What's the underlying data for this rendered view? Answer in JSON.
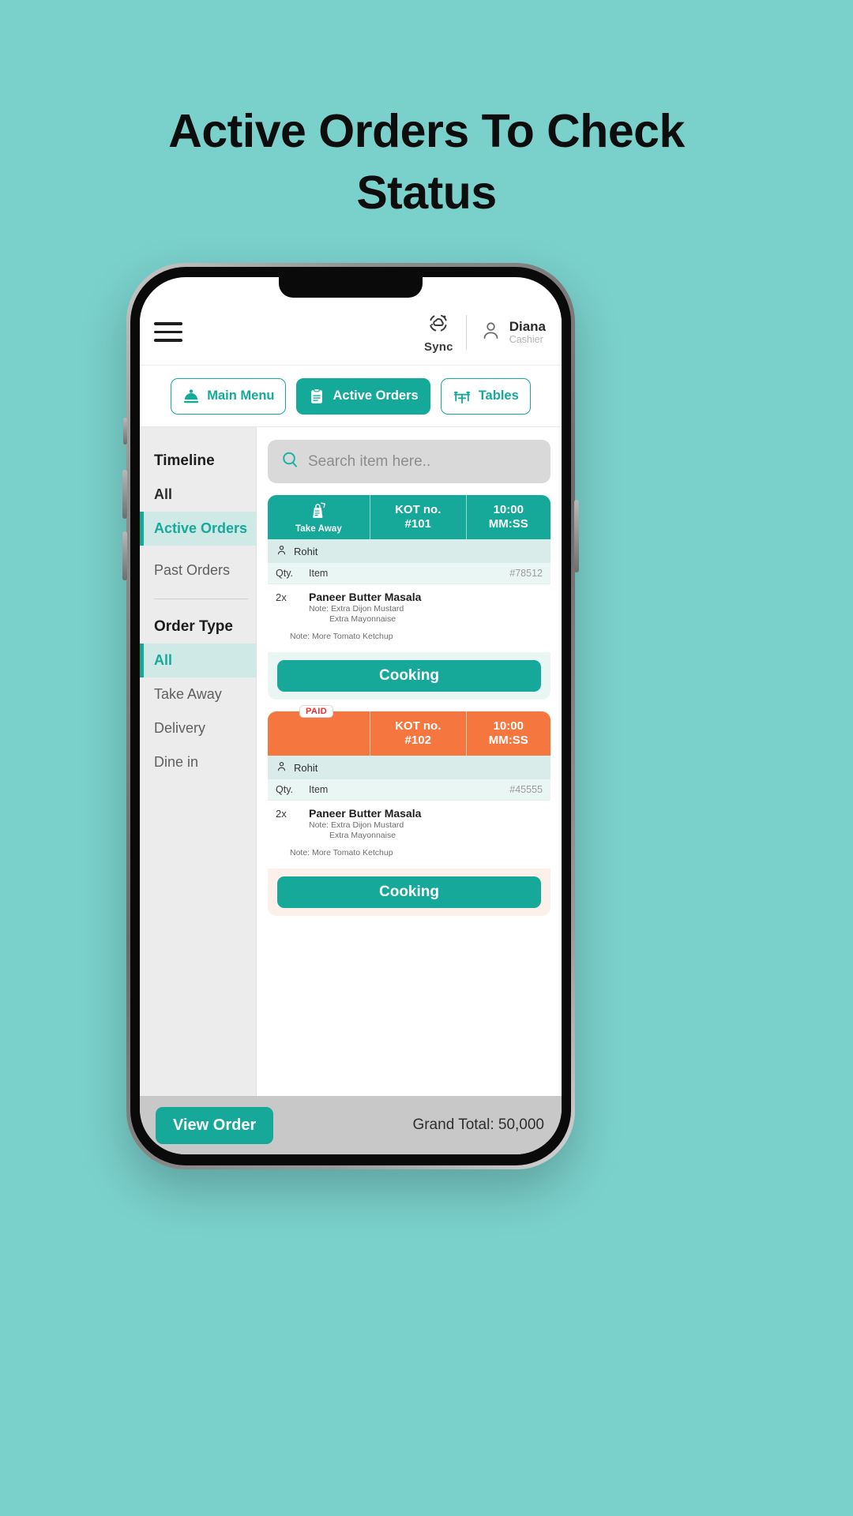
{
  "headline": "Active Orders To Check Status",
  "colors": {
    "background": "#7ad0cb",
    "accent": "#15a99a",
    "paid_accent": "#f5773f",
    "paid_text": "#ee2d2d"
  },
  "header": {
    "menu_icon": "hamburger-icon",
    "sync_icon": "cloud-sync-icon",
    "sync_label": "Sync",
    "user_icon": "person-icon",
    "user_name": "Diana",
    "user_role": "Cashier"
  },
  "tabs": [
    {
      "label": "Main Menu",
      "icon": "cloche-icon",
      "active": false
    },
    {
      "label": "Active Orders",
      "icon": "clipboard-icon",
      "active": true
    },
    {
      "label": "Tables",
      "icon": "table-chairs-icon",
      "active": false
    }
  ],
  "sidebar": {
    "groups": [
      {
        "title": "Timeline",
        "items": [
          {
            "label": "All",
            "active": false,
            "style": "plain"
          },
          {
            "label": "Active Orders",
            "active": true,
            "style": "normal"
          },
          {
            "label": "Past Orders",
            "active": false,
            "style": "normal"
          }
        ]
      },
      {
        "title": "Order Type",
        "items": [
          {
            "label": "All",
            "active": true,
            "style": "normal"
          },
          {
            "label": "Take Away",
            "active": false,
            "style": "normal"
          },
          {
            "label": "Delivery",
            "active": false,
            "style": "normal"
          },
          {
            "label": "Dine in",
            "active": false,
            "style": "normal"
          }
        ]
      }
    ]
  },
  "search": {
    "icon": "search-icon",
    "placeholder": "Search item here..",
    "value": ""
  },
  "orders": [
    {
      "order_type": "Take Away",
      "type_icon": "takeaway-bag-icon",
      "kot_label": "KOT no.",
      "kot_number": "#101",
      "time": "10:00",
      "time_unit": "MM:SS",
      "paid": false,
      "paid_label": "",
      "customer_name": "Rohit",
      "customer_icon": "person-icon",
      "col_qty": "Qty.",
      "col_item": "Item",
      "order_id": "#78512",
      "items": [
        {
          "qty": "2x",
          "name": "Paneer Butter Masala",
          "note_1": "Note: Extra Dijon Mustard",
          "note_2": "Extra Mayonnaise"
        }
      ],
      "order_note": "Note: More Tomato Ketchup",
      "status": "Cooking"
    },
    {
      "order_type": "",
      "type_icon": "",
      "kot_label": "KOT no.",
      "kot_number": "#102",
      "time": "10:00",
      "time_unit": "MM:SS",
      "paid": true,
      "paid_label": "PAID",
      "customer_name": "Rohit",
      "customer_icon": "person-icon",
      "col_qty": "Qty.",
      "col_item": "Item",
      "order_id": "#45555",
      "items": [
        {
          "qty": "2x",
          "name": "Paneer Butter Masala",
          "note_1": "Note: Extra Dijon Mustard",
          "note_2": "Extra Mayonnaise"
        }
      ],
      "order_note": "Note: More Tomato Ketchup",
      "status": "Cooking"
    }
  ],
  "footer": {
    "view_order_label": "View Order",
    "grand_total": "Grand Total: 50,000"
  }
}
